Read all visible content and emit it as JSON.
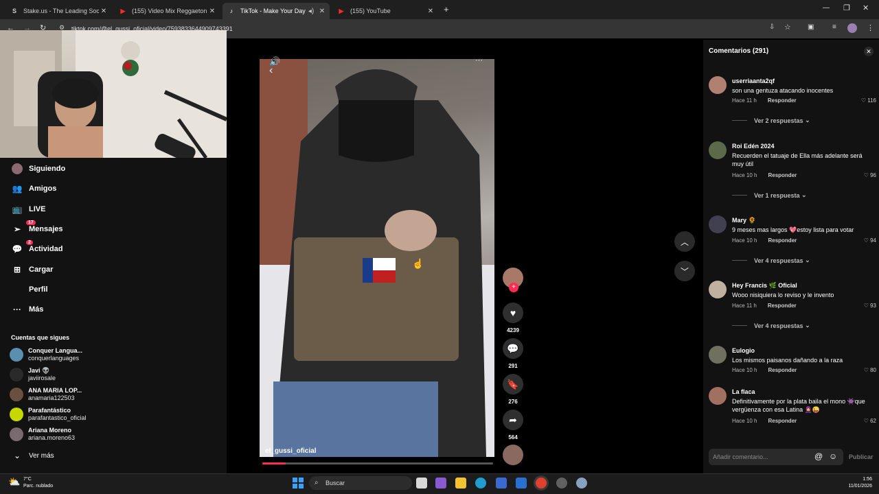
{
  "browser": {
    "tabs": [
      {
        "favicon": "S",
        "title": "Stake.us - The Leading Social C",
        "active": false
      },
      {
        "favicon": "▶",
        "title": "(155) Video Mix Reggaeton Vie",
        "active": false
      },
      {
        "favicon": "♪",
        "title": "TikTok - Make Your Day",
        "active": true
      },
      {
        "favicon": "▶",
        "title": "(155) YouTube",
        "active": false
      }
    ],
    "url": "tiktok.com/@el_gussi_oficial/video/7593833644909743391"
  },
  "sidebar": {
    "items": [
      {
        "label": "Siguiendo",
        "icon": "following-icon"
      },
      {
        "label": "Amigos",
        "icon": "friends-icon"
      },
      {
        "label": "LIVE",
        "icon": "live-icon"
      },
      {
        "label": "Mensajes",
        "icon": "messages-icon",
        "badge": "17"
      },
      {
        "label": "Actividad",
        "icon": "activity-icon",
        "badge": "2"
      },
      {
        "label": "Cargar",
        "icon": "upload-icon"
      },
      {
        "label": "Perfil",
        "icon": "profile-icon"
      },
      {
        "label": "Más",
        "icon": "more-icon"
      }
    ],
    "following_title": "Cuentas que sigues",
    "following": [
      {
        "name": "Conquer Langua...",
        "handle": "conquerlanguages",
        "color": "#5a8fb0"
      },
      {
        "name": "Javi 👽",
        "handle": "javiirosale",
        "color": "#2a2a2a"
      },
      {
        "name": "ANA MARIA LOP...",
        "handle": "anamaria122503",
        "color": "#6a5040"
      },
      {
        "name": "Parafantástico",
        "handle": "parafantastico_oficial",
        "color": "#c6d800"
      },
      {
        "name": "Ariana Moreno",
        "handle": "ariana.moreno63",
        "color": "#7a6a70"
      }
    ],
    "see_more": "Ver más"
  },
  "video": {
    "author": "el_gussi_oficial",
    "progress": 0.1,
    "likes": "4239",
    "comments": "291",
    "saves": "276",
    "shares": "564"
  },
  "comments": {
    "title": "Comentarios",
    "count": "(291)",
    "list": [
      {
        "user": "userriaanta2qf",
        "text": "son una gentuza atacando inocentes",
        "time": "Hace 11 h",
        "reply": "Responder",
        "likes": "116",
        "more": "Ver 2 respuestas",
        "color": "#b08070"
      },
      {
        "user": "Roi Edén 2024",
        "text": "Recuerden el tatuaje de Ella más adelante será muy útil",
        "time": "Hace 10 h",
        "reply": "Responder",
        "likes": "96",
        "more": "Ver 1 respuesta",
        "color": "#5a6a4a"
      },
      {
        "user": "Mary 🌻",
        "text": "9 meses mas largos 💖estoy lista para votar",
        "time": "Hace 10 h",
        "reply": "Responder",
        "likes": "94",
        "more": "Ver 4 respuestas",
        "color": "#404050"
      },
      {
        "user": "Hey Francis 🌿 Oficial",
        "text": "Wooo nisiquiera lo reviso y le invento",
        "time": "Hace 11 h",
        "reply": "Responder",
        "likes": "93",
        "more": "Ver 4 respuestas",
        "color": "#c0b0a0"
      },
      {
        "user": "Eulogio",
        "text": "Los mismos paisanos dañando a la raza",
        "time": "Hace 10 h",
        "reply": "Responder",
        "likes": "80",
        "more": "",
        "color": "#707060"
      },
      {
        "user": "La flaca",
        "text": "Definitivamente por la plata baila el mono 👾que vergüenza con esa Latina 🧕😜",
        "time": "Hace 10 h",
        "reply": "Responder",
        "likes": "62",
        "more": "",
        "color": "#a07060"
      }
    ],
    "input_placeholder": "Añadir comentario...",
    "publish": "Publicar"
  },
  "taskbar": {
    "weather_temp": "7°C",
    "weather_desc": "Parc. nublado",
    "search": "Buscar",
    "time": "1:56",
    "date": "11/01/2026"
  }
}
